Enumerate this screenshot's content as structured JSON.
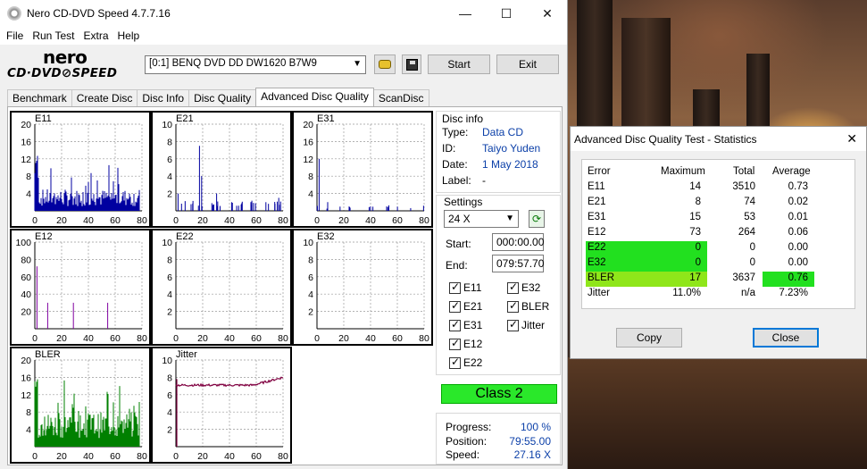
{
  "window": {
    "title": "Nero CD-DVD Speed 4.7.7.16",
    "minimize": "—",
    "maximize": "☐",
    "close": "✕"
  },
  "menu": [
    "File",
    "Run Test",
    "Extra",
    "Help"
  ],
  "logo": {
    "line1": "nero",
    "line2": "CD·DVD⊘SPEED"
  },
  "toolbar": {
    "drive": "[0:1]   BENQ DVD DD DW1620 B7W9",
    "start": "Start",
    "exit": "Exit"
  },
  "tabs": [
    "Benchmark",
    "Create Disc",
    "Disc Info",
    "Disc Quality",
    "Advanced Disc Quality",
    "ScanDisc"
  ],
  "active_tab": "Advanced Disc Quality",
  "disc_info": {
    "group_title": "Disc info",
    "type_label": "Type:",
    "type": "Data CD",
    "id_label": "ID:",
    "id": "Taiyo Yuden",
    "date_label": "Date:",
    "date": "1 May 2018",
    "label_label": "Label:",
    "label": "-"
  },
  "settings": {
    "group_title": "Settings",
    "speed": "24 X",
    "start_label": "Start:",
    "start": "000:00.00",
    "end_label": "End:",
    "end": "079:57.70",
    "checks": [
      "E11",
      "E32",
      "E21",
      "BLER",
      "E31",
      "Jitter",
      "E12",
      "E22"
    ]
  },
  "class_label": "Class 2",
  "progress": {
    "progress_label": "Progress:",
    "progress": "100 %",
    "position_label": "Position:",
    "position": "79:55.00",
    "speed_label": "Speed:",
    "speed": "27.16 X"
  },
  "chart_data": [
    {
      "type": "bar",
      "title": "E11",
      "ylim": [
        0,
        20
      ],
      "yticks": [
        "20",
        "16",
        "12",
        "8",
        "4"
      ],
      "xticks": [
        "0",
        "20",
        "40",
        "60",
        "80"
      ],
      "series_color": "#0000a0"
    },
    {
      "type": "bar",
      "title": "E21",
      "ylim": [
        0,
        10
      ],
      "yticks": [
        "10",
        "8",
        "6",
        "4",
        "2"
      ],
      "xticks": [
        "0",
        "20",
        "40",
        "60",
        "80"
      ],
      "series_color": "#0000a0"
    },
    {
      "type": "bar",
      "title": "E31",
      "ylim": [
        0,
        20
      ],
      "yticks": [
        "20",
        "16",
        "12",
        "8",
        "4"
      ],
      "xticks": [
        "0",
        "20",
        "40",
        "60",
        "80"
      ],
      "series_color": "#0000a0"
    },
    {
      "type": "bar",
      "title": "E12",
      "ylim": [
        0,
        100
      ],
      "yticks": [
        "100",
        "80",
        "60",
        "40",
        "20"
      ],
      "xticks": [
        "0",
        "20",
        "40",
        "60",
        "80"
      ],
      "series_color": "#8000a0"
    },
    {
      "type": "bar",
      "title": "E22",
      "ylim": [
        0,
        10
      ],
      "yticks": [
        "10",
        "8",
        "6",
        "4",
        "2"
      ],
      "xticks": [
        "0",
        "20",
        "40",
        "60",
        "80"
      ],
      "series_color": "#0000a0"
    },
    {
      "type": "bar",
      "title": "E32",
      "ylim": [
        0,
        10
      ],
      "yticks": [
        "10",
        "8",
        "6",
        "4",
        "2"
      ],
      "xticks": [
        "0",
        "20",
        "40",
        "60",
        "80"
      ],
      "series_color": "#0000a0"
    },
    {
      "type": "bar",
      "title": "BLER",
      "ylim": [
        0,
        20
      ],
      "yticks": [
        "20",
        "16",
        "12",
        "8",
        "4"
      ],
      "xticks": [
        "0",
        "20",
        "40",
        "60",
        "80"
      ],
      "series_color": "#008000"
    },
    {
      "type": "line",
      "title": "Jitter",
      "ylim": [
        0,
        10
      ],
      "yticks": [
        "10",
        "8",
        "6",
        "4",
        "2"
      ],
      "xticks": [
        "0",
        "20",
        "40",
        "60",
        "80"
      ],
      "series_color": "#800040"
    }
  ],
  "stats_dialog": {
    "title": "Advanced Disc Quality Test - Statistics",
    "headers": [
      "Error",
      "Maximum",
      "Total",
      "Average"
    ],
    "rows": [
      [
        "E11",
        "14",
        "3510",
        "0.73"
      ],
      [
        "E21",
        "8",
        "74",
        "0.02"
      ],
      [
        "E31",
        "15",
        "53",
        "0.01"
      ],
      [
        "E12",
        "73",
        "264",
        "0.06"
      ],
      [
        "E22",
        "0",
        "0",
        "0.00"
      ],
      [
        "E32",
        "0",
        "0",
        "0.00"
      ],
      [
        "BLER",
        "17",
        "3637",
        "0.76"
      ],
      [
        "Jitter",
        "11.0%",
        "n/a",
        "7.23%"
      ]
    ],
    "copy": "Copy",
    "close": "Close",
    "highlight_color": "#22e01f",
    "bler_color": "#8fe61a"
  }
}
